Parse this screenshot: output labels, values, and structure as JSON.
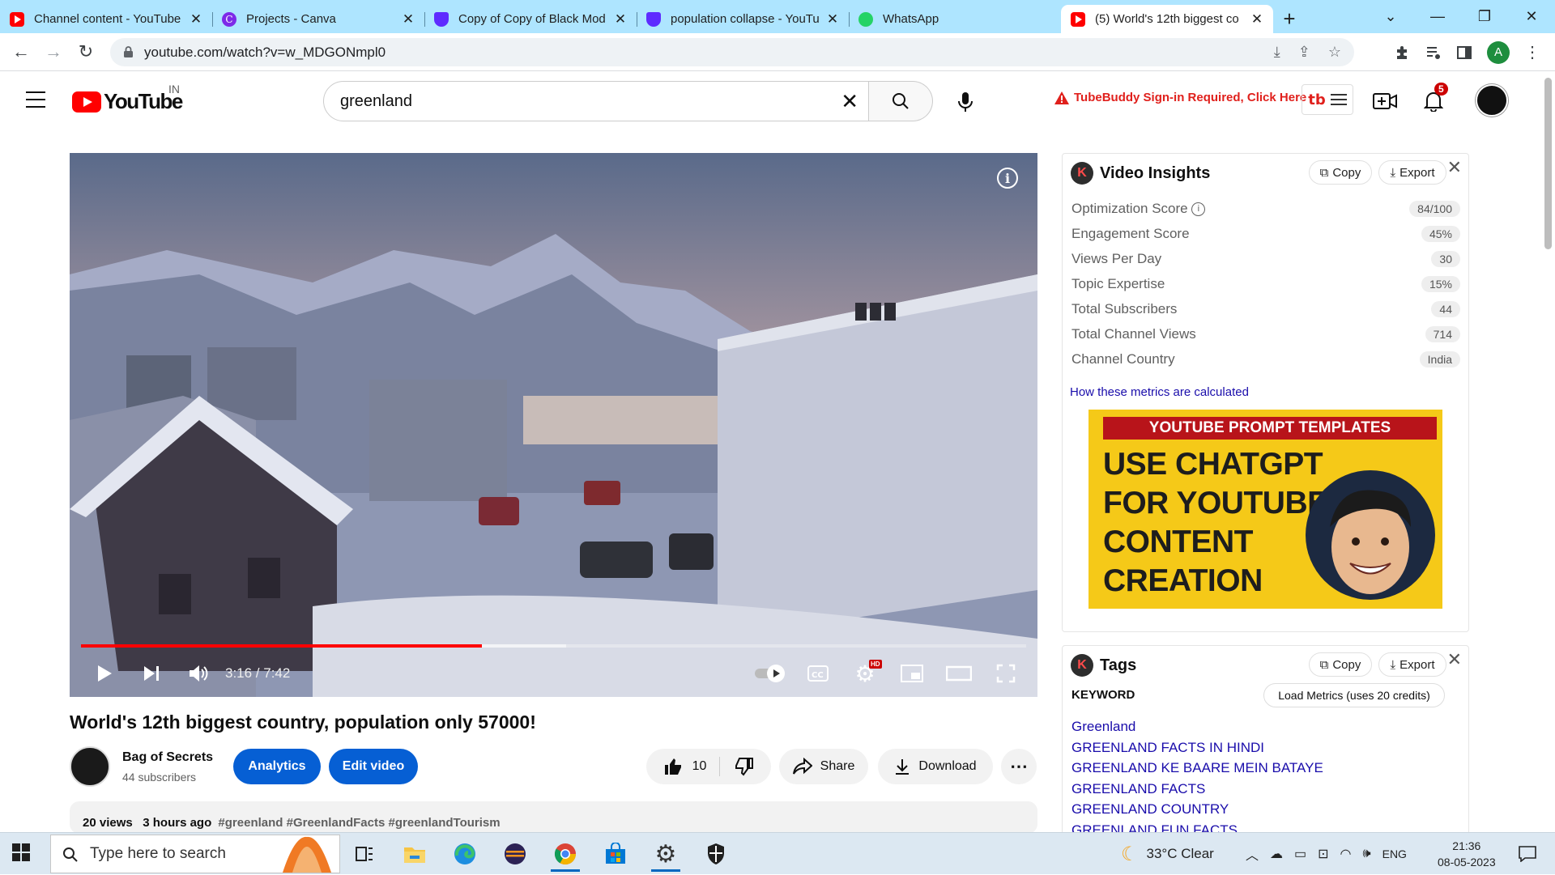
{
  "browser": {
    "tabs": [
      {
        "title": "Channel content - YouTube",
        "favicon_color": "#ff0000"
      },
      {
        "title": "Projects - Canva",
        "favicon_color": "#7d2ae8"
      },
      {
        "title": "Copy of Copy of Black Mod",
        "favicon_color": "#5e2bff"
      },
      {
        "title": "population collapse - YouTu",
        "favicon_color": "#5e2bff"
      },
      {
        "title": "WhatsApp",
        "favicon_color": "#25d366"
      },
      {
        "title": "(5) World's 12th biggest co",
        "favicon_color": "#ff0000",
        "active": true
      }
    ],
    "url": "youtube.com/watch?v=w_MDGONmpl0",
    "profile_initial": "A"
  },
  "youtube": {
    "logo_text": "YouTube",
    "country_code": "IN",
    "search_value": "greenland",
    "tubebuddy_warning": "TubeBuddy Sign-in Required, Click Here",
    "notification_count": "5",
    "brand_color": "#ff0000"
  },
  "player": {
    "time_display": "3:16 / 7:42",
    "progress_fraction": 0.4242,
    "buffer_fraction": 0.513,
    "hd_badge": "HD"
  },
  "video": {
    "title": "World's 12th biggest country, population only 57000!",
    "channel_name": "Bag of Secrets",
    "subscribers": "44 subscribers",
    "analytics_label": "Analytics",
    "edit_label": "Edit video",
    "likes": "10",
    "share_label": "Share",
    "download_label": "Download",
    "views": "20 views",
    "age": "3 hours ago",
    "hashtags": "#greenland #GreenlandFacts #greenlandTourism"
  },
  "insights": {
    "title": "Video Insights",
    "copy_label": "Copy",
    "export_label": "Export",
    "metrics": [
      {
        "label": "Optimization Score",
        "value": "84/100"
      },
      {
        "label": "Engagement Score",
        "value": "45%"
      },
      {
        "label": "Views Per Day",
        "value": "30"
      },
      {
        "label": "Topic Expertise",
        "value": "15%"
      },
      {
        "label": "Total Subscribers",
        "value": "44"
      },
      {
        "label": "Total Channel Views",
        "value": "714"
      },
      {
        "label": "Channel Country",
        "value": "India"
      }
    ],
    "how_link": "How these metrics are calculated",
    "promo": {
      "banner": "YOUTUBE PROMPT TEMPLATES",
      "line1": "USE CHATGPT",
      "line2": "FOR YOUTUBE",
      "line3": "CONTENT",
      "line4": "CREATION"
    }
  },
  "tags": {
    "title": "Tags",
    "copy_label": "Copy",
    "export_label": "Export",
    "keyword_header": "KEYWORD",
    "load_metrics": "Load Metrics (uses 20 credits)",
    "items": [
      "Greenland",
      "GREENLAND FACTS IN HINDI",
      "GREENLAND KE BAARE MEIN BATAYE",
      "GREENLAND FACTS",
      "GREENLAND COUNTRY",
      "GREENLAND FUN FACTS"
    ]
  },
  "taskbar": {
    "search_placeholder": "Type here to search",
    "weather": "33°C  Clear",
    "language": "ENG",
    "time": "21:36",
    "date": "08-05-2023"
  }
}
